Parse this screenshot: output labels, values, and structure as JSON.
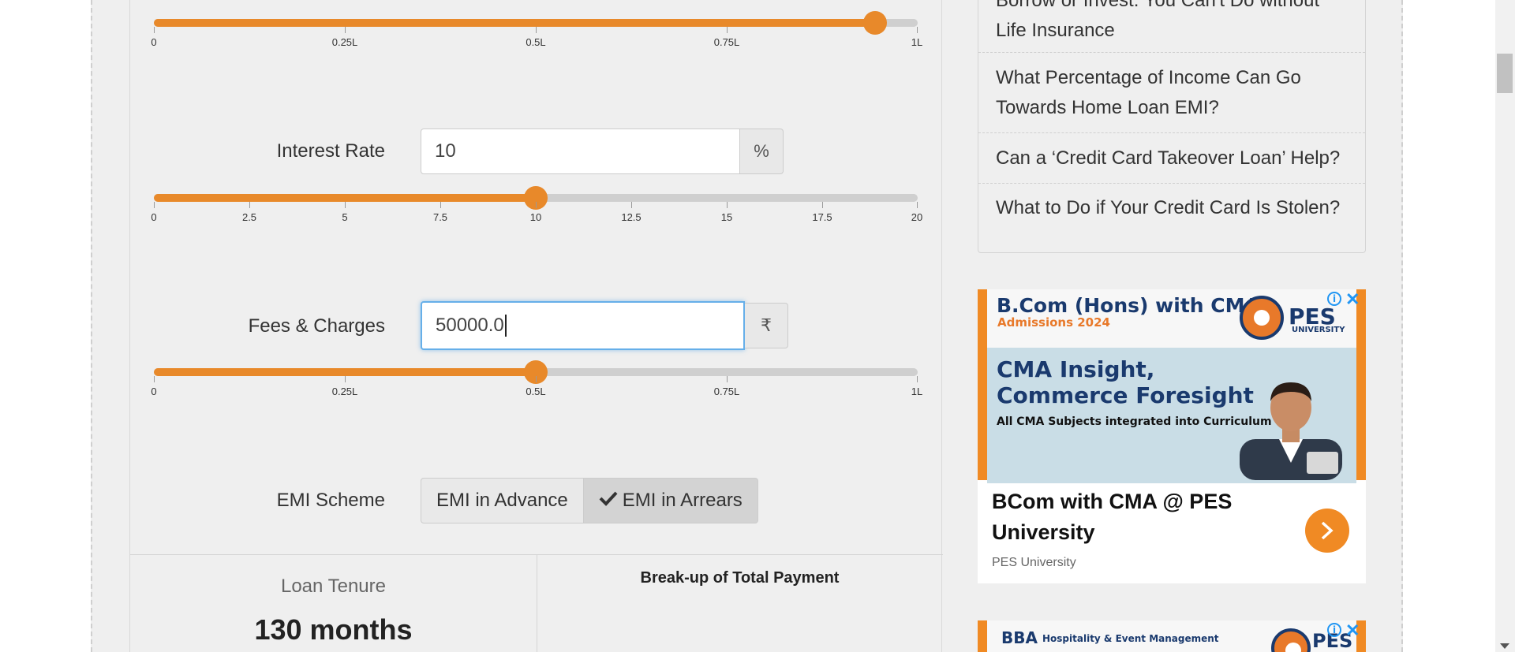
{
  "calculator": {
    "loan_slider": {
      "tick_labels": [
        "0",
        "0.25L",
        "0.5L",
        "0.75L",
        "1L"
      ],
      "value_fraction": 0.944
    },
    "interest_rate": {
      "label": "Interest Rate",
      "value": "10",
      "unit": "%",
      "tick_labels": [
        "0",
        "2.5",
        "5",
        "7.5",
        "10",
        "12.5",
        "15",
        "17.5",
        "20"
      ],
      "value_fraction": 0.5
    },
    "fees_charges": {
      "label": "Fees & Charges",
      "value": "50000.0",
      "unit": "₹",
      "tick_labels": [
        "0",
        "0.25L",
        "0.5L",
        "0.75L",
        "1L"
      ],
      "value_fraction": 0.5
    },
    "emi_scheme": {
      "label": "EMI Scheme",
      "option_advance": "EMI in Advance",
      "option_arrears": "EMI in Arrears",
      "selected": "EMI in Arrears"
    },
    "results": {
      "tenure_label": "Loan Tenure",
      "tenure_value": "130 months",
      "breakup_title": "Break-up of Total Payment"
    }
  },
  "sidebar": {
    "articles": [
      {
        "line1": "Borrow or Invest: You Can't Do without",
        "line2": "Life Insurance"
      },
      {
        "line1": "What Percentage of Income Can Go",
        "line2": "Towards Home Loan EMI?"
      },
      {
        "line1": "Can a ‘Credit Card Takeover Loan’ Help?"
      },
      {
        "line1": "What to Do if Your Credit Card Is Stolen?"
      }
    ]
  },
  "ad1": {
    "headline": "B.Com (Hons) with CMA",
    "subline": "Admissions 2024",
    "logo_text": "PES",
    "logo_subtext": "UNIVERSITY",
    "big_line1": "CMA Insight,",
    "big_line2": "Commerce Foresight",
    "small_text": "All CMA Subjects integrated into Curriculum",
    "title_line1": "BCom with CMA @ PES",
    "title_line2": "University",
    "advertiser": "PES University"
  },
  "ad2": {
    "headline": "BBA",
    "headline_small": "Hospitality & Event Management",
    "logo_text": "PES"
  },
  "colors": {
    "accent": "#e8892a",
    "ad_blue": "#1a3a6e"
  }
}
